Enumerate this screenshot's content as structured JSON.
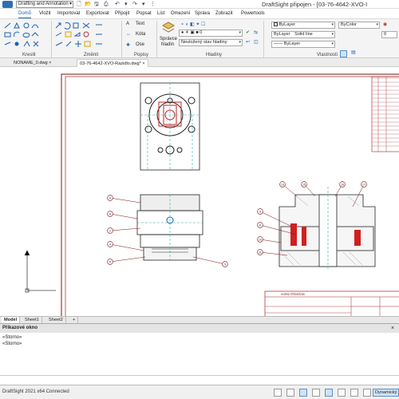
{
  "titlebar": {
    "workspace": "Drafting and Annotation",
    "title": "DraftSight připojen - [03-76-4642-XVO-I"
  },
  "ribbon_tabs": [
    "Domů",
    "Vložit",
    "Importovat",
    "Exportovat",
    "Připojit",
    "Popsat",
    "List",
    "Omezení",
    "Správa",
    "Zobrazit",
    "Powertools"
  ],
  "ribbon": {
    "kreslit_label": "Kreslit",
    "zmenit_label": "Změnit",
    "popisy_label": "Popisy",
    "popisy_text": "Text",
    "popisy_kota": "Kóta",
    "popisy_ose": "Ose",
    "spravce_line1": "Správce",
    "spravce_line2": "hladin",
    "layer_combo": "0",
    "layer_state": "Neuložený stav hladiny",
    "hladiny_label": "Hladiny",
    "color_combo": "ByLayer",
    "linetype_combo": "ByLayer",
    "linetype_name": "Solid line",
    "lineweight_combo": "ByLayer",
    "bycolor_combo": "ByColor",
    "number_field": "0",
    "vlastnosti_label": "Vlastnosti"
  },
  "doc_tabs": [
    {
      "label": "NONAME_0.dwg",
      "active": false
    },
    {
      "label": "03-76-4642-XVO-Razidlo.dwg*",
      "active": true
    }
  ],
  "layout_tabs": [
    {
      "label": "Model",
      "active": true
    },
    {
      "label": "Sheet1",
      "active": false
    },
    {
      "label": "Sheet2",
      "active": false
    },
    {
      "label": "+",
      "active": false
    }
  ],
  "command": {
    "header": "Příkazové okno",
    "lines": [
      "«Storno»",
      "«Storno»"
    ]
  },
  "drawing": {
    "callouts_left": [
      "6",
      "8",
      "2",
      "4",
      "5"
    ],
    "callout_bottom": "3",
    "callouts_right": [
      "13",
      "15",
      "16",
      "17",
      "9",
      "8",
      "10",
      "11"
    ],
    "title_block": "HORNÍ PŘÍDRŽNÍK"
  },
  "status": {
    "text": "DraftSight 2021 x64 Connected",
    "dynamic": "Dynamický"
  }
}
